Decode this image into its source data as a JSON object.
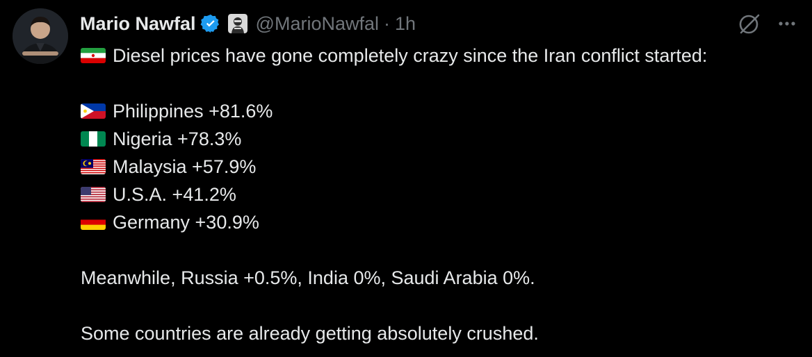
{
  "author": {
    "name": "Mario Nawfal",
    "handle": "@MarioNawfal",
    "separator": "·",
    "time": "1h"
  },
  "icons": {
    "verified": "verified-badge-icon",
    "affiliation": "affiliation-badge-icon",
    "grok": "grok-icon",
    "more": "more-options-icon"
  },
  "colors": {
    "background": "#000000",
    "text": "#e7e9ea",
    "muted": "#71767b",
    "verified_blue": "#1d9bf0"
  },
  "post": {
    "intro_flag": "iran-flag",
    "intro": "Diesel prices have gone completely crazy since the Iran conflict started:",
    "items": [
      {
        "flag": "philippines-flag",
        "text": "Philippines +81.6%"
      },
      {
        "flag": "nigeria-flag",
        "text": "Nigeria +78.3%"
      },
      {
        "flag": "malaysia-flag",
        "text": "Malaysia +57.9%"
      },
      {
        "flag": "usa-flag",
        "text": "U.S.A. +41.2%"
      },
      {
        "flag": "germany-flag",
        "text": "Germany +30.9%"
      }
    ],
    "meanwhile": "Meanwhile, Russia +0.5%, India 0%, Saudi Arabia 0%.",
    "closing": "Some countries are already getting absolutely crushed."
  }
}
